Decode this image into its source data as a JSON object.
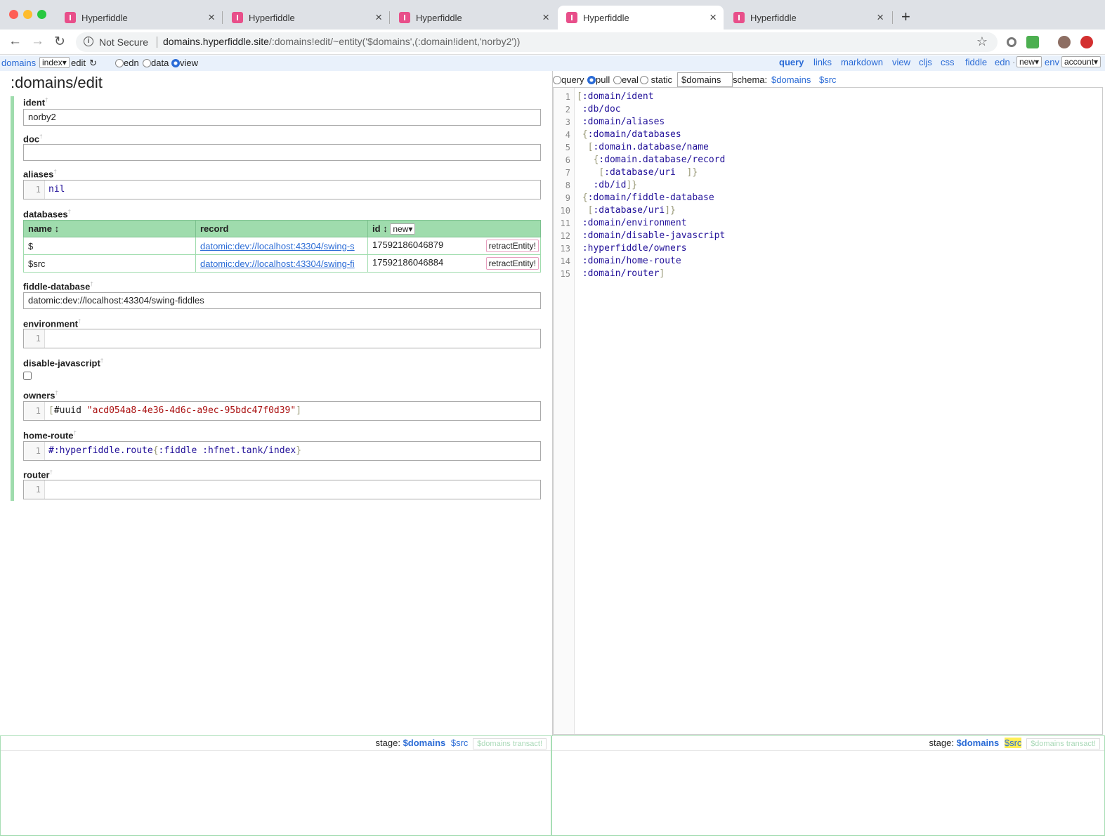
{
  "browser": {
    "tabs": [
      {
        "title": "Hyperfiddle",
        "active": false
      },
      {
        "title": "Hyperfiddle",
        "active": false
      },
      {
        "title": "Hyperfiddle",
        "active": false
      },
      {
        "title": "Hyperfiddle",
        "active": true
      },
      {
        "title": "Hyperfiddle",
        "active": false
      }
    ],
    "security": "Not Secure",
    "url_host": "domains.hyperfiddle.site",
    "url_path": "/:domains!edit/~entity('$domains',(:domain!ident,'norby2'))"
  },
  "header": {
    "domains_link": "domains",
    "index_select": "index",
    "edit_label": "edit",
    "refresh_glyph": "↻",
    "mode_edn": "edn",
    "mode_data": "data",
    "mode_view": "view",
    "selected_mode": "view",
    "right_links": [
      "query",
      "links",
      "markdown",
      "view",
      "cljs",
      "css",
      "fiddle"
    ],
    "edn_link": "edn",
    "new_select": "new",
    "env_link": "env",
    "account_select": "account"
  },
  "left": {
    "title": ":domains/edit",
    "fields": {
      "ident": {
        "label": "ident",
        "value": "norby2"
      },
      "doc": {
        "label": "doc",
        "value": ""
      },
      "aliases": {
        "label": "aliases",
        "line": "1",
        "value": "nil"
      },
      "databases": {
        "label": "databases"
      },
      "fiddle_database": {
        "label": "fiddle-database",
        "value": "datomic:dev://localhost:43304/swing-fiddles"
      },
      "environment": {
        "label": "environment",
        "line": "1",
        "value": ""
      },
      "disable_javascript": {
        "label": "disable-javascript",
        "checked": false
      },
      "owners": {
        "label": "owners",
        "line": "1",
        "tag": "#uuid",
        "value": "\"acd054a8-4e36-4d6c-a9ec-95bdc47f0d39\""
      },
      "home_route": {
        "label": "home-route",
        "line": "1",
        "fn": "#:hyperfiddle.route",
        "key1": ":fiddle",
        "val1": ":hfnet.tank/index"
      },
      "router": {
        "label": "router",
        "line": "1",
        "value": ""
      }
    },
    "table": {
      "headers": {
        "name": "name",
        "record": "record",
        "id": "id",
        "sort_glyph": "↕",
        "new": "new"
      },
      "rows": [
        {
          "name": "$",
          "record": "datomic:dev://localhost:43304/swing-s",
          "id": "17592186046879",
          "action": "retractEntity!"
        },
        {
          "name": "$src",
          "record": "datomic:dev://localhost:43304/swing-fi",
          "id": "17592186046884",
          "action": "retractEntity!"
        }
      ]
    },
    "stage": {
      "label": "stage:",
      "db1": "$domains",
      "db2": "$src",
      "transact": "$domains transact!"
    }
  },
  "right": {
    "modes": {
      "query": "query",
      "pull": "pull",
      "eval": "eval",
      "static": "static",
      "selected": "pull"
    },
    "db_input": "$domains",
    "schema_label": "schema:",
    "schema_links": [
      "$domains",
      "$src"
    ],
    "code": {
      "line_numbers": [
        "1",
        "2",
        "3",
        "4",
        "5",
        "6",
        "7",
        "8",
        "9",
        "10",
        "11",
        "12",
        "13",
        "14",
        "15"
      ],
      "kw": {
        "ident": ":domain/ident",
        "doc": ":db/doc",
        "aliases": ":domain/aliases",
        "databases": ":domain/databases",
        "dbname": ":domain.database/name",
        "dbrecord": ":domain.database/record",
        "dburi": ":database/uri",
        "dbid": ":db/id",
        "fiddledb": ":domain/fiddle-database",
        "dburi2": ":database/uri",
        "environment": ":domain/environment",
        "disablejs": ":domain/disable-javascript",
        "owners": ":hyperfiddle/owners",
        "homeroute": ":domain/home-route",
        "router": ":domain/router"
      }
    },
    "stage": {
      "label": "stage:",
      "db1": "$domains",
      "db2": "$src",
      "transact": "$domains transact!"
    }
  },
  "colors": {
    "accent": "#2a6bd6",
    "green": "#9fdcad",
    "retract_border": "#e7a0c0",
    "highlight": "#ffee55"
  }
}
